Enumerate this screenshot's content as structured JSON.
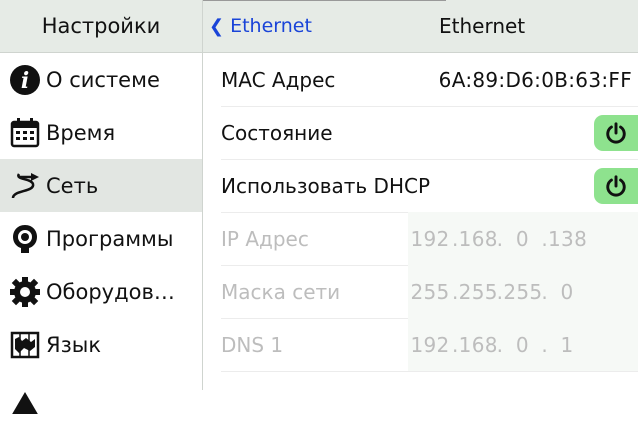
{
  "sidebar": {
    "title": "Настройки",
    "items": [
      {
        "label": "О системе",
        "icon": "info-icon",
        "active": false
      },
      {
        "label": "Время",
        "icon": "calendar-icon",
        "active": false
      },
      {
        "label": "Сеть",
        "icon": "network-icon",
        "active": true
      },
      {
        "label": "Программы",
        "icon": "apps-icon",
        "active": false
      },
      {
        "label": "Оборудов…",
        "icon": "gear-icon",
        "active": false
      },
      {
        "label": "Язык",
        "icon": "map-icon",
        "active": false
      }
    ]
  },
  "header": {
    "back_label": "Ethernet",
    "title": "Ethernet"
  },
  "rows": {
    "mac": {
      "label": "MAC Адрес",
      "value": "6A:89:D6:0B:63:FF"
    },
    "state": {
      "label": "Состояние",
      "on": true
    },
    "dhcp": {
      "label": "Использовать DHCP",
      "on": true
    },
    "ip": {
      "label": "IP Адрес",
      "octets": [
        "192",
        "168",
        "0",
        "138"
      ]
    },
    "mask": {
      "label": "Маска сети",
      "octets": [
        "255",
        "255",
        "255",
        "0"
      ]
    },
    "dns1": {
      "label": "DNS 1",
      "octets": [
        "192",
        "168",
        "0",
        "1"
      ]
    }
  },
  "colors": {
    "accent": "#1a44d8",
    "toggle_on": "#8ee28e",
    "header_bg": "#e6ebe6",
    "disabled_text": "#bdbdbd"
  }
}
